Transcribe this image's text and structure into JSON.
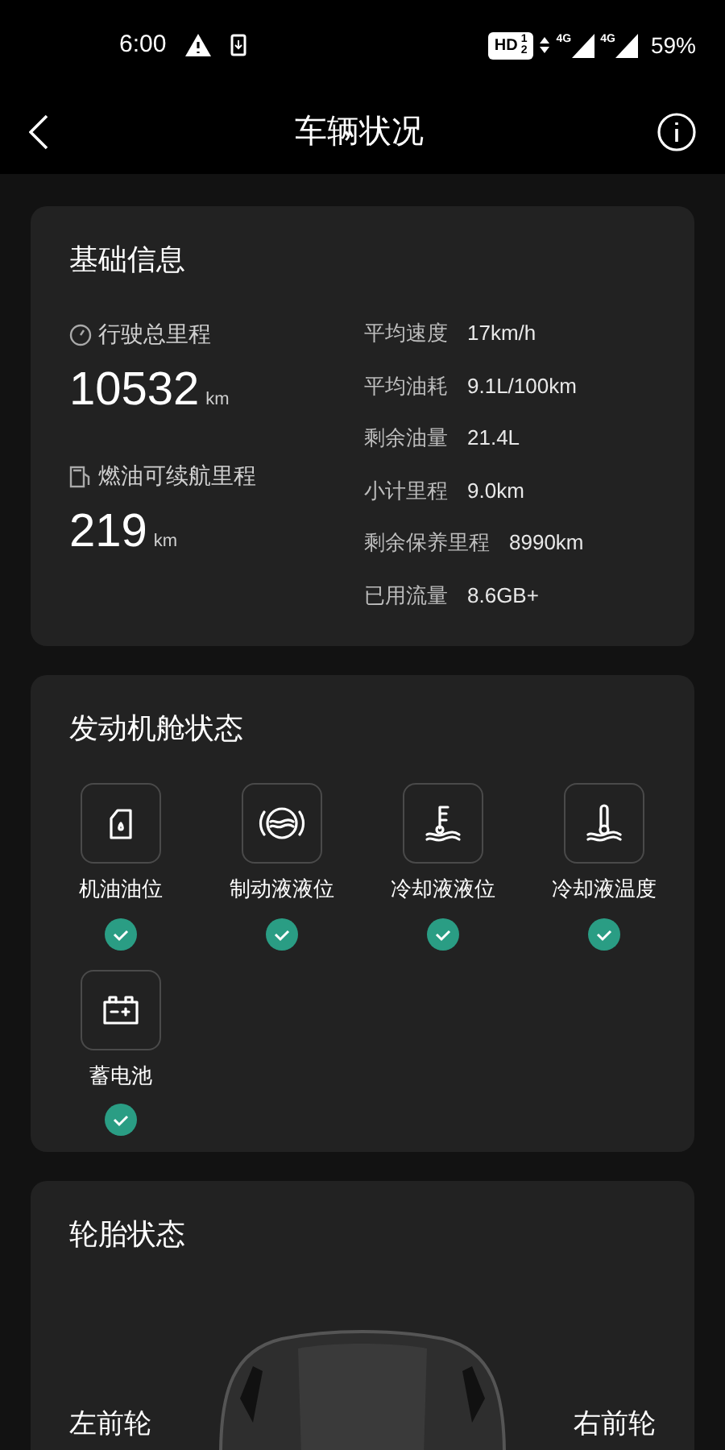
{
  "status_bar": {
    "time": "6:00",
    "hd": "HD",
    "sim_slots": [
      "1",
      "2"
    ],
    "networks": [
      "4G",
      "4G"
    ],
    "battery": "59%"
  },
  "header": {
    "title": "车辆状况"
  },
  "basic_info": {
    "title": "基础信息",
    "total_mileage": {
      "label": "行驶总里程",
      "value": "10532",
      "unit": "km"
    },
    "fuel_range": {
      "label": "燃油可续航里程",
      "value": "219",
      "unit": "km"
    },
    "stats": [
      {
        "label": "平均速度",
        "value": "17km/h"
      },
      {
        "label": "平均油耗",
        "value": "9.1L/100km"
      },
      {
        "label": "剩余油量",
        "value": "21.4L"
      },
      {
        "label": "小计里程",
        "value": "9.0km"
      },
      {
        "label": "剩余保养里程",
        "value": "8990km"
      },
      {
        "label": "已用流量",
        "value": "8.6GB+"
      }
    ]
  },
  "engine_bay": {
    "title": "发动机舱状态",
    "items": [
      {
        "kind": "oil",
        "label": "机油油位",
        "ok": true
      },
      {
        "kind": "brake",
        "label": "制动液液位",
        "ok": true
      },
      {
        "kind": "coolant_level",
        "label": "冷却液液位",
        "ok": true
      },
      {
        "kind": "coolant_temp",
        "label": "冷却液温度",
        "ok": true
      },
      {
        "kind": "battery",
        "label": "蓄电池",
        "ok": true
      }
    ]
  },
  "tires": {
    "title": "轮胎状态",
    "wheels": [
      "左前轮",
      "右前轮"
    ]
  }
}
